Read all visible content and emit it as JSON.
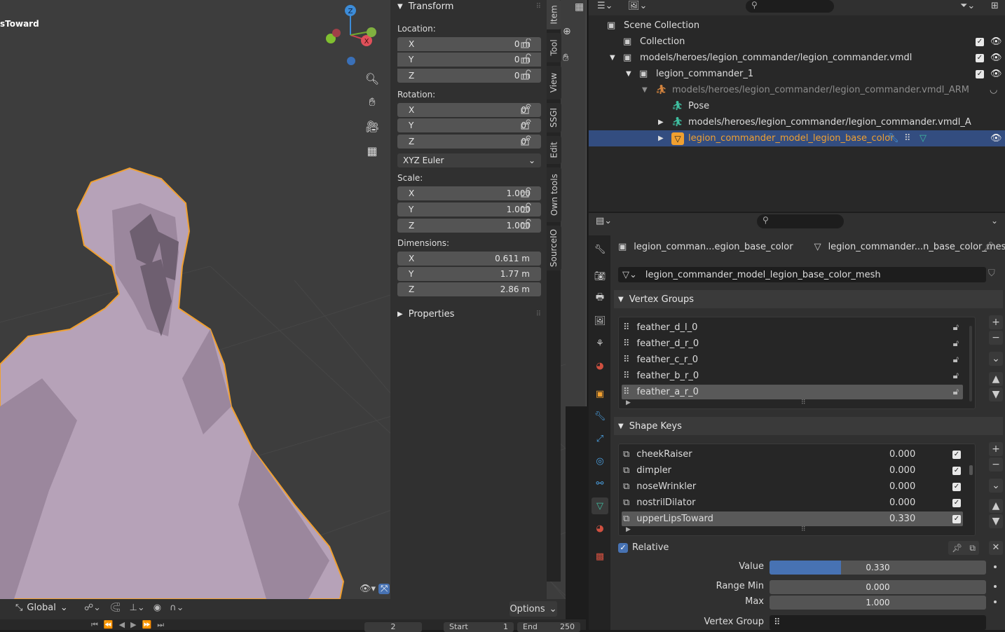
{
  "viewport": {
    "object_label": "sToward",
    "gizmo": {
      "z": "Z",
      "x": "X"
    },
    "header_left": {
      "orientation": "Global"
    },
    "options_label": "Options",
    "timeline": {
      "frame": "2",
      "start_label": "Start",
      "start": "1",
      "end_label": "End",
      "end": "250"
    }
  },
  "npanel": {
    "transform_title": "Transform",
    "location_label": "Location:",
    "location": [
      {
        "axis": "X",
        "value": "0 m"
      },
      {
        "axis": "Y",
        "value": "0 m"
      },
      {
        "axis": "Z",
        "value": "0 m"
      }
    ],
    "rotation_label": "Rotation:",
    "rotation": [
      {
        "axis": "X",
        "value": "0°"
      },
      {
        "axis": "Y",
        "value": "0°"
      },
      {
        "axis": "Z",
        "value": "0°"
      }
    ],
    "rotation_mode": "XYZ Euler",
    "scale_label": "Scale:",
    "scale": [
      {
        "axis": "X",
        "value": "1.000"
      },
      {
        "axis": "Y",
        "value": "1.000"
      },
      {
        "axis": "Z",
        "value": "1.000"
      }
    ],
    "dimensions_label": "Dimensions:",
    "dimensions": [
      {
        "axis": "X",
        "value": "0.611 m"
      },
      {
        "axis": "Y",
        "value": "1.77 m"
      },
      {
        "axis": "Z",
        "value": "2.86 m"
      }
    ],
    "properties_title": "Properties",
    "tabs": [
      "Item",
      "Tool",
      "View",
      "SSGI",
      "Edit",
      "Own tools",
      "SourceIO"
    ]
  },
  "outliner": {
    "rows": [
      {
        "label": "Scene Collection",
        "icon": "scene-collection-icon"
      },
      {
        "label": "Collection",
        "icon": "collection-icon"
      },
      {
        "label": "models/heroes/legion_commander/legion_commander.vmdl",
        "icon": "collection-icon"
      },
      {
        "label": "legion_commander_1",
        "icon": "collection-icon"
      },
      {
        "label": "models/heroes/legion_commander/legion_commander.vmdl_ARM",
        "icon": "armature-icon"
      },
      {
        "label": "Pose",
        "icon": "pose-icon"
      },
      {
        "label": "models/heroes/legion_commander/legion_commander.vmdl_ARM_DAT",
        "icon": "armature-data-icon"
      },
      {
        "label": "legion_commander_model_legion_base_color",
        "icon": "mesh-object-icon"
      }
    ]
  },
  "properties": {
    "breadcrumb_object": "legion_comman...egion_base_color",
    "breadcrumb_mesh": "legion_commander...n_base_color_mesh",
    "mesh_name": "legion_commander_model_legion_base_color_mesh",
    "vertex_groups_title": "Vertex Groups",
    "vertex_groups": [
      "feather_d_l_0",
      "feather_d_r_0",
      "feather_c_r_0",
      "feather_b_r_0",
      "feather_a_r_0"
    ],
    "shape_keys_title": "Shape Keys",
    "shape_keys": [
      {
        "name": "cheekRaiser",
        "value": "0.000"
      },
      {
        "name": "dimpler",
        "value": "0.000"
      },
      {
        "name": "noseWrinkler",
        "value": "0.000"
      },
      {
        "name": "nostrilDilator",
        "value": "0.000"
      },
      {
        "name": "upperLipsToward",
        "value": "0.330"
      }
    ],
    "relative_label": "Relative",
    "value_label": "Value",
    "value": "0.330",
    "value_fraction": 0.33,
    "range_min_label": "Range Min",
    "range_min": "0.000",
    "max_label": "Max",
    "max": "1.000",
    "vertex_group_label": "Vertex Group"
  },
  "colors": {
    "selection_outline": "#f0a030",
    "active_row": "#334d80",
    "value_fill": "#4772b3",
    "mesh": "#b6a2b8"
  }
}
